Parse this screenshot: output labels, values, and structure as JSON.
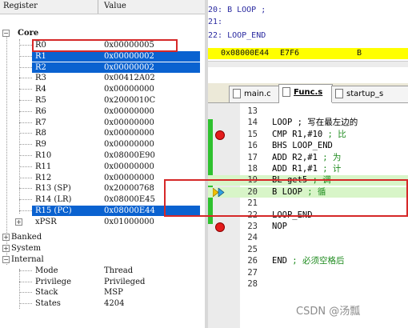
{
  "registers_header": {
    "col_register": "Register",
    "col_value": "Value"
  },
  "core": {
    "label": "Core",
    "rows": [
      {
        "name": "R0",
        "value": "0x00000005"
      },
      {
        "name": "R1",
        "value": "0x00000002"
      },
      {
        "name": "R2",
        "value": "0x00000002"
      },
      {
        "name": "R3",
        "value": "0x00412A02"
      },
      {
        "name": "R4",
        "value": "0x00000000"
      },
      {
        "name": "R5",
        "value": "0x2000010C"
      },
      {
        "name": "R6",
        "value": "0x00000000"
      },
      {
        "name": "R7",
        "value": "0x00000000"
      },
      {
        "name": "R8",
        "value": "0x00000000"
      },
      {
        "name": "R9",
        "value": "0x00000000"
      },
      {
        "name": "R10",
        "value": "0x08000E90"
      },
      {
        "name": "R11",
        "value": "0x00000000"
      },
      {
        "name": "R12",
        "value": "0x00000000"
      },
      {
        "name": "R13 (SP)",
        "value": "0x20000768"
      },
      {
        "name": "R14 (LR)",
        "value": "0x08000E45"
      },
      {
        "name": "R15 (PC)",
        "value": "0x08000E44"
      },
      {
        "name": "xPSR",
        "value": "0x01000000"
      }
    ]
  },
  "groups": {
    "banked": "Banked",
    "system": "System",
    "internal": "Internal"
  },
  "internal": {
    "rows": [
      {
        "name": "Mode",
        "value": "Thread"
      },
      {
        "name": "Privilege",
        "value": "Privileged"
      },
      {
        "name": "Stack",
        "value": "MSP"
      },
      {
        "name": "States",
        "value": "4204"
      }
    ]
  },
  "disassembly": {
    "line20": "20:            B LOOP       ;",
    "line21": "21:",
    "line22": "22: LOOP_END",
    "pc_addr": "0x08000E44",
    "pc_opcode": "E7F6",
    "pc_instr": "B"
  },
  "tabs": {
    "main": "main.c",
    "funcs": "Func.s",
    "startup": "startup_s"
  },
  "code": {
    "lines": [
      {
        "n": "13",
        "code": ""
      },
      {
        "n": "14",
        "code": "LOOP    ; 写在最左边的"
      },
      {
        "n": "15",
        "code": "    CMP R1,#10    ; 比"
      },
      {
        "n": "16",
        "code": "    BHS LOOP_END"
      },
      {
        "n": "17",
        "code": "    ADD R2,#1     ; 为"
      },
      {
        "n": "18",
        "code": "    ADD R1,#1     ; 计"
      },
      {
        "n": "19",
        "code": "    BL get5       ; 调"
      },
      {
        "n": "20",
        "code": "    B LOOP        ; 循"
      },
      {
        "n": "21",
        "code": ""
      },
      {
        "n": "22",
        "code": "LOOP_END"
      },
      {
        "n": "23",
        "code": "    NOP"
      },
      {
        "n": "24",
        "code": ""
      },
      {
        "n": "25",
        "code": ""
      },
      {
        "n": "26",
        "code": "    END  ; 必须空格后"
      },
      {
        "n": "27",
        "code": ""
      },
      {
        "n": "28",
        "code": ""
      }
    ]
  },
  "watermark": "CSDN @汤瓢",
  "colors": {
    "selection": "#0a62d0",
    "highlight_box": "#d62828",
    "pc_bar": "#ffff00",
    "breakpoint": "#e41c1c",
    "keyword": "#1a1ad8",
    "comment": "#1c8a1c"
  }
}
